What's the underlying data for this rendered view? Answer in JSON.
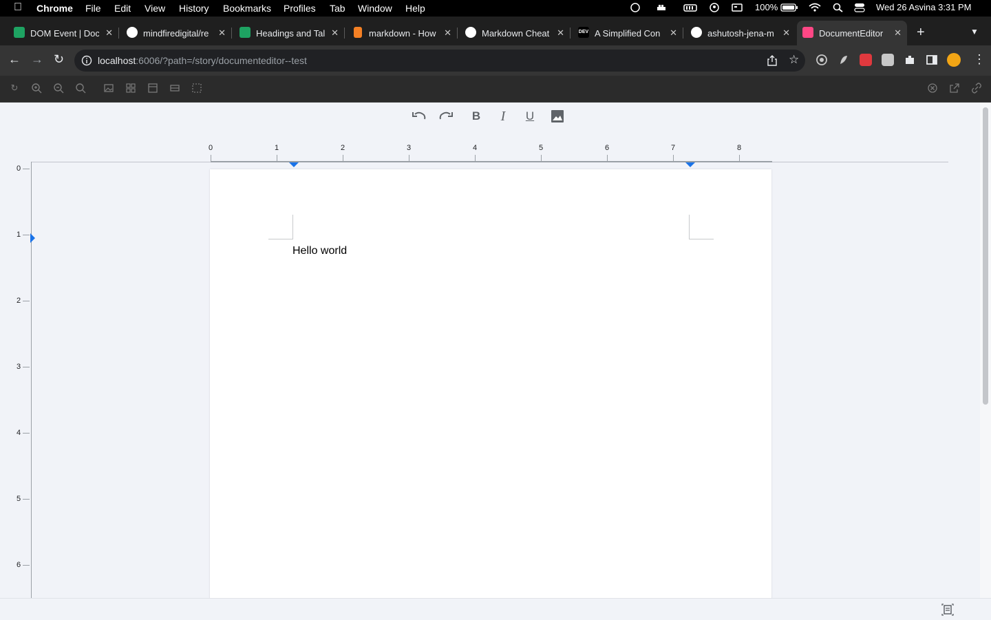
{
  "menubar": {
    "apple": "",
    "items": [
      "Chrome",
      "File",
      "Edit",
      "View",
      "History",
      "Bookmarks",
      "Profiles",
      "Tab",
      "Window",
      "Help"
    ],
    "battery": "100%",
    "datetime": "Wed 26 Asvina  3:31 PM"
  },
  "tabs": [
    {
      "label": "DOM Event | Doc",
      "favicon": "sheets-icon",
      "color": "#1ea362"
    },
    {
      "label": "mindfiredigital/re",
      "favicon": "github-icon",
      "color": "#ffffff"
    },
    {
      "label": "Headings and Tal",
      "favicon": "sheets-icon",
      "color": "#1ea362"
    },
    {
      "label": "markdown - How",
      "favicon": "stackoverflow-icon",
      "color": "#f48024"
    },
    {
      "label": "Markdown Cheat",
      "favicon": "github-icon",
      "color": "#ffffff"
    },
    {
      "label": "A Simplified Con",
      "favicon": "dev-icon",
      "color": "#000000"
    },
    {
      "label": "ashutosh-jena-m",
      "favicon": "github-icon",
      "color": "#ffffff"
    },
    {
      "label": "DocumentEditor",
      "favicon": "storybook-icon",
      "color": "#ff4785",
      "active": true
    }
  ],
  "address": {
    "host": "localhost",
    "rest": ":6006/?path=/story/documenteditor--test"
  },
  "ruler": {
    "horizontal": [
      "0",
      "1",
      "2",
      "3",
      "4",
      "5",
      "6",
      "7",
      "8"
    ],
    "vertical": [
      "0",
      "1",
      "2",
      "3",
      "4",
      "5",
      "6"
    ]
  },
  "document": {
    "text": "Hello world"
  },
  "colors": {
    "accent": "#1a73e8",
    "page": "#ffffff",
    "background": "#f1f3f8"
  }
}
